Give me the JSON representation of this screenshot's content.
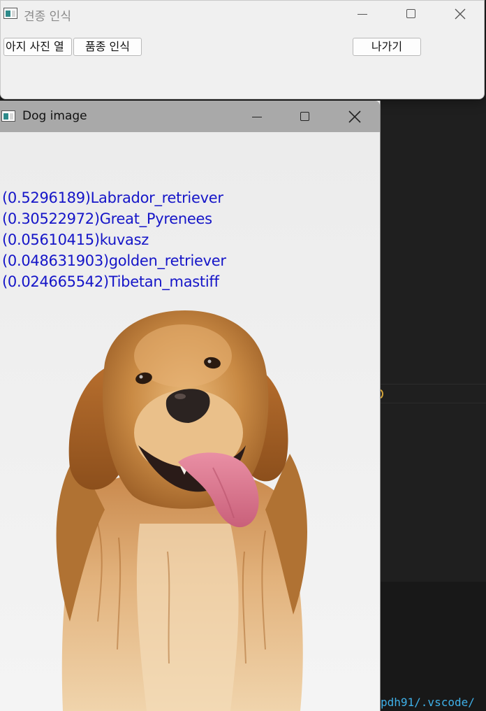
{
  "main_window": {
    "title": "견종 인식",
    "buttons": {
      "open_photo": "아지 사진 열",
      "recognize_breed": "품종 인식",
      "exit": "나가기"
    }
  },
  "dog_window": {
    "title": "Dog image",
    "predictions": [
      "(0.5296189)Labrador_retriever",
      "(0.30522972)Great_Pyrenees",
      "(0.05610415)kuvasz",
      "(0.048631903)golden_retriever",
      "(0.024665542)Tibetan_mastiff"
    ],
    "image": "golden-retriever-photo"
  },
  "background_editor": {
    "terminal_text": "pdh91/.vscode/"
  },
  "colors": {
    "prediction_text": "#1515c8",
    "terminal_text": "#3fb0e8",
    "editor_bg": "#1e1e1e"
  }
}
